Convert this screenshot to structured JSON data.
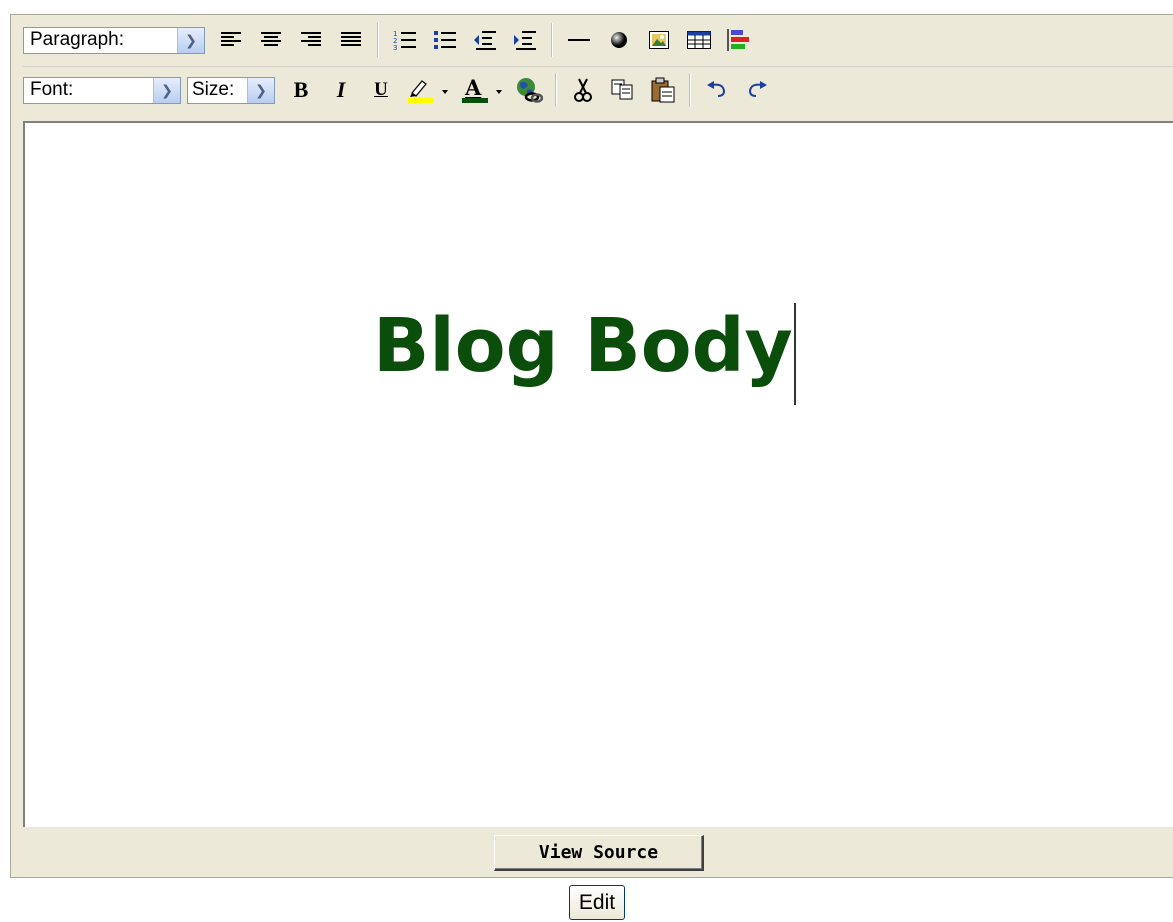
{
  "toolbar": {
    "paragraph_select": "Paragraph:",
    "font_select": "Font:",
    "size_select": "Size:",
    "bold_label": "B",
    "italic_label": "I",
    "underline_label": "U",
    "font_color_label": "A"
  },
  "icons": {
    "row1": [
      "align-left-icon",
      "align-center-icon",
      "align-right-icon",
      "justify-icon",
      "ordered-list-icon",
      "unordered-list-icon",
      "outdent-icon",
      "indent-icon",
      "horizontal-rule-icon",
      "special-char-icon",
      "insert-image-icon",
      "insert-table-icon",
      "layers-icon"
    ],
    "row2": [
      "bold-icon",
      "italic-icon",
      "underline-icon",
      "highlight-icon",
      "font-color-icon",
      "insert-link-icon",
      "cut-icon",
      "copy-icon",
      "paste-icon",
      "undo-icon",
      "redo-icon"
    ]
  },
  "colors": {
    "heading": "#0b4d0b",
    "highlight": "#ffff00",
    "font_color_bar": "#0b4d0b"
  },
  "content": {
    "heading": "Blog Body"
  },
  "footer": {
    "view_source_label": "View Source",
    "edit_label": "Edit"
  }
}
